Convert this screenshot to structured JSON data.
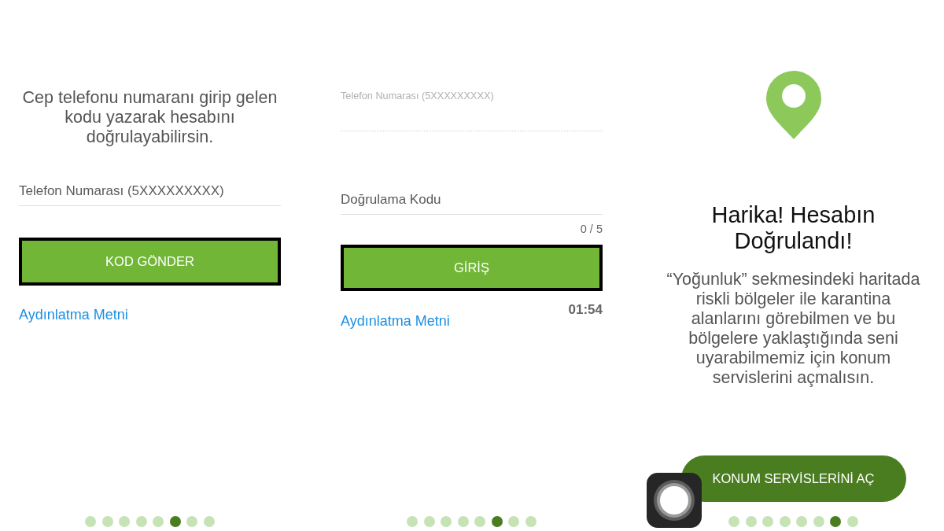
{
  "panels": [
    {
      "kind": "form",
      "instruction": "Cep telefonu numaranı girip gelen kodu yazarak hesabını doğrulayabilirsin.",
      "fields": [
        {
          "placeholder": "Telefon Numarası (5XXXXXXXXX)",
          "disabled": false
        }
      ],
      "button": "KOD GÖNDER",
      "link": "Aydınlatma Metni",
      "page_dots": [
        {
          "selected": false
        },
        {
          "selected": false
        },
        {
          "selected": false
        },
        {
          "selected": false
        },
        {
          "selected": false
        },
        {
          "selected": true
        },
        {
          "selected": false
        },
        {
          "selected": false
        }
      ]
    },
    {
      "kind": "form",
      "fields": [
        {
          "placeholder": "Telefon Numarası (5XXXXXXXXX)",
          "disabled": true
        },
        {
          "placeholder": "Doğrulama Kodu",
          "disabled": false,
          "counter": "0 / 5"
        }
      ],
      "button": "GİRİŞ",
      "timer": "01:54",
      "link": "Aydınlatma Metni",
      "page_dots": [
        {
          "selected": false
        },
        {
          "selected": false
        },
        {
          "selected": false
        },
        {
          "selected": false
        },
        {
          "selected": false
        },
        {
          "selected": true
        },
        {
          "selected": false
        },
        {
          "selected": false
        }
      ]
    },
    {
      "kind": "permission",
      "title": "Harika! Hesabın Doğrulandı!",
      "message": "“Yoğunluk” sekmesindeki haritada riskli bölgeler ile karantina alanlarını görebilmen ve bu bölgelere yaklaştığında seni uyarabilmemiz için konum servislerini açmalısın.",
      "button": "KONUM SERVİSLERİNİ AÇ",
      "page_dots": [
        {
          "selected": false
        },
        {
          "selected": false
        },
        {
          "selected": false
        },
        {
          "selected": false
        },
        {
          "selected": false
        },
        {
          "selected": false
        },
        {
          "selected": true
        },
        {
          "selected": false
        }
      ]
    }
  ]
}
